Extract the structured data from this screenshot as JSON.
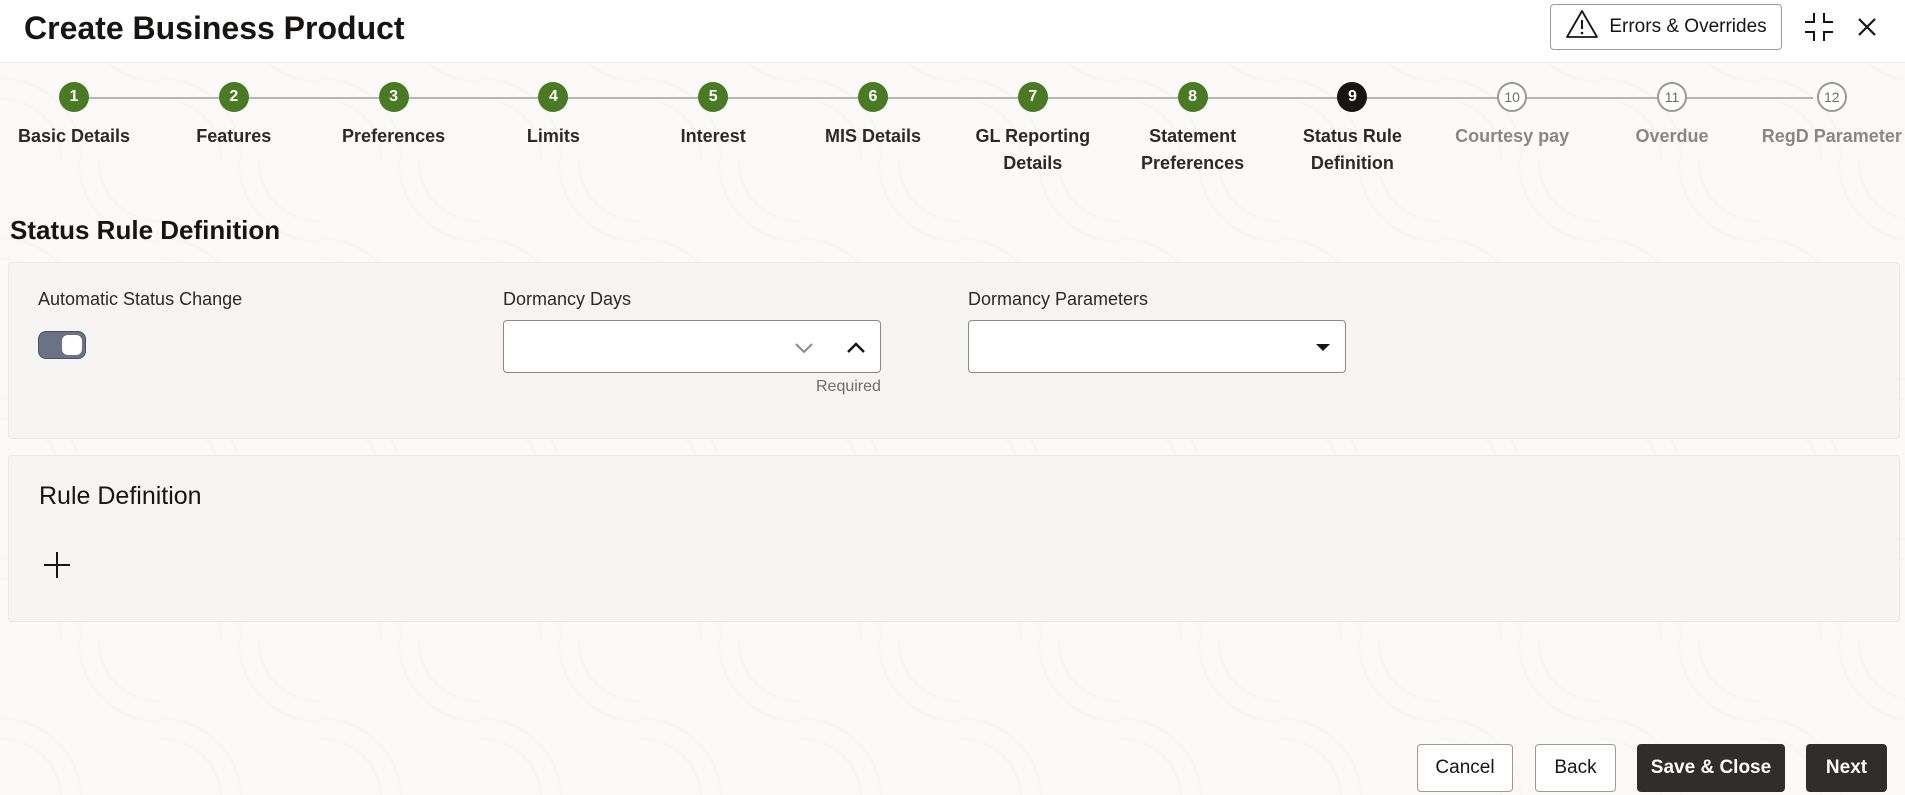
{
  "header": {
    "title": "Create Business Product",
    "errors_label": "Errors & Overrides",
    "icons": [
      "warning-icon",
      "collapse-icon",
      "close-icon"
    ]
  },
  "stepper": {
    "steps": [
      {
        "number": "1",
        "label": "Basic Details",
        "state": "done"
      },
      {
        "number": "2",
        "label": "Features",
        "state": "done"
      },
      {
        "number": "3",
        "label": "Preferences",
        "state": "done"
      },
      {
        "number": "4",
        "label": "Limits",
        "state": "done"
      },
      {
        "number": "5",
        "label": "Interest",
        "state": "done"
      },
      {
        "number": "6",
        "label": "MIS Details",
        "state": "done"
      },
      {
        "number": "7",
        "label": "GL Reporting Details",
        "state": "done"
      },
      {
        "number": "8",
        "label": "Statement Preferences",
        "state": "done"
      },
      {
        "number": "9",
        "label": "Status Rule Definition",
        "state": "current"
      },
      {
        "number": "10",
        "label": "Courtesy pay",
        "state": "todo"
      },
      {
        "number": "11",
        "label": "Overdue",
        "state": "todo"
      },
      {
        "number": "12",
        "label": "RegD Parameter",
        "state": "todo"
      }
    ],
    "colors": {
      "done": "#4a7a24",
      "current": "#161513",
      "todo": "#9b9894"
    }
  },
  "section": {
    "title": "Status Rule Definition",
    "automatic_status_change": {
      "label": "Automatic Status Change",
      "on": true
    },
    "dormancy_days": {
      "label": "Dormancy Days",
      "value": "",
      "helper": "Required"
    },
    "dormancy_parameters": {
      "label": "Dormancy Parameters",
      "value": ""
    }
  },
  "rule_definition": {
    "title": "Rule Definition",
    "add_icon": "plus-icon"
  },
  "footer": {
    "cancel": "Cancel",
    "back": "Back",
    "save_close": "Save & Close",
    "next": "Next"
  }
}
